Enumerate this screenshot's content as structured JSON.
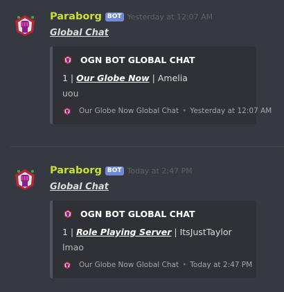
{
  "messages": [
    {
      "author": "Paraborg",
      "bot_tag": "BOT",
      "timestamp": "Yesterday at 12:07 AM",
      "link_text": "Global Chat",
      "embed": {
        "author_name": "OGN BOT GLOBAL CHAT",
        "title_prefix": "1 |",
        "server": "Our Globe Now",
        "separator": "|",
        "user": "Amelia",
        "description": "uou",
        "footer_text": "Our Globe Now Global Chat",
        "footer_separator": "•",
        "footer_time": "Yesterday at 12:07 AM"
      }
    },
    {
      "author": "Paraborg",
      "bot_tag": "BOT",
      "timestamp": "Today at 2:47 PM",
      "link_text": "Global Chat",
      "embed": {
        "author_name": "OGN BOT GLOBAL CHAT",
        "title_prefix": "1 |",
        "server": "Role Playing Server",
        "separator": "|",
        "user": "ItsJustTaylor",
        "description": "lmao",
        "footer_text": "Our Globe Now Global Chat",
        "footer_separator": "•",
        "footer_time": "Today at 2:47 PM"
      }
    }
  ],
  "colors": {
    "background": "#36393f",
    "embed_bg": "#2f3136",
    "username": "#c8e02d",
    "bot_tag": "#7289da"
  },
  "icons": {
    "avatar": "fist-logo-icon"
  }
}
